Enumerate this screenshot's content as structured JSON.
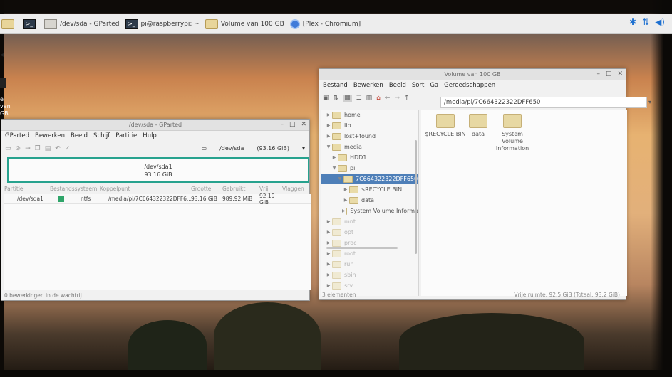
{
  "taskbar": {
    "items": [
      {
        "label": "/dev/sda - GParted",
        "icon": "gparted-icon"
      },
      {
        "label": "pi@raspberrypi: ~",
        "icon": "terminal-icon"
      },
      {
        "label": "Volume van 100 GB",
        "icon": "folder-icon"
      },
      {
        "label": "[Plex - Chromium]",
        "icon": "chromium-icon"
      }
    ],
    "terminal_glyph": ">_"
  },
  "desktop": {
    "icon_label": "e van GB"
  },
  "gparted": {
    "title": "/dev/sda - GParted",
    "menu": [
      "GParted",
      "Bewerken",
      "Beeld",
      "Schijf",
      "Partitie",
      "Hulp"
    ],
    "device_name": "/dev/sda",
    "device_size": "(93.16 GiB)",
    "partition_label": "/dev/sda1",
    "partition_size": "93.16 GiB",
    "columns": [
      "Partitie",
      "Bestandssysteem",
      "Koppelpunt",
      "Grootte",
      "Gebruikt",
      "Vrij",
      "Vlaggen"
    ],
    "rows": [
      {
        "partition": "/dev/sda1",
        "fs": "ntfs",
        "mount": "/media/pi/7C664322322DFF6...",
        "size": "93.16 GiB",
        "used": "989.92 MiB",
        "free": "92.19 GiB",
        "flags": ""
      }
    ],
    "status": "0 bewerkingen in de wachtrij"
  },
  "filemanager": {
    "title": "Volume van 100 GB",
    "menu": [
      "Bestand",
      "Bewerken",
      "Beeld",
      "Sort",
      "Ga",
      "Gereedschappen"
    ],
    "path": "/media/pi/7C664322322DFF650",
    "tree": [
      {
        "label": "home",
        "indent": 0,
        "state": "normal"
      },
      {
        "label": "lib",
        "indent": 0,
        "state": "normal"
      },
      {
        "label": "lost+found",
        "indent": 0,
        "state": "normal"
      },
      {
        "label": "media",
        "indent": 0,
        "state": "open"
      },
      {
        "label": "HDD1",
        "indent": 1,
        "state": "normal"
      },
      {
        "label": "pi",
        "indent": 1,
        "state": "open"
      },
      {
        "label": "7C664322322DFF650",
        "indent": 2,
        "state": "selected"
      },
      {
        "label": "$RECYCLE.BIN",
        "indent": 3,
        "state": "normal"
      },
      {
        "label": "data",
        "indent": 3,
        "state": "normal"
      },
      {
        "label": "System Volume Informa",
        "indent": 3,
        "state": "normal"
      },
      {
        "label": "mnt",
        "indent": 0,
        "state": "faded"
      },
      {
        "label": "opt",
        "indent": 0,
        "state": "faded"
      },
      {
        "label": "proc",
        "indent": 0,
        "state": "faded"
      },
      {
        "label": "root",
        "indent": 0,
        "state": "faded"
      },
      {
        "label": "run",
        "indent": 0,
        "state": "faded"
      },
      {
        "label": "sbin",
        "indent": 0,
        "state": "faded"
      },
      {
        "label": "srv",
        "indent": 0,
        "state": "faded"
      }
    ],
    "files": [
      "$RECYCLE.BIN",
      "data",
      "System Volume Information"
    ],
    "status_left": "3 elementen",
    "status_right": "Vrije ruimte: 92.5 GiB (Totaal: 93.2 GiB)"
  }
}
